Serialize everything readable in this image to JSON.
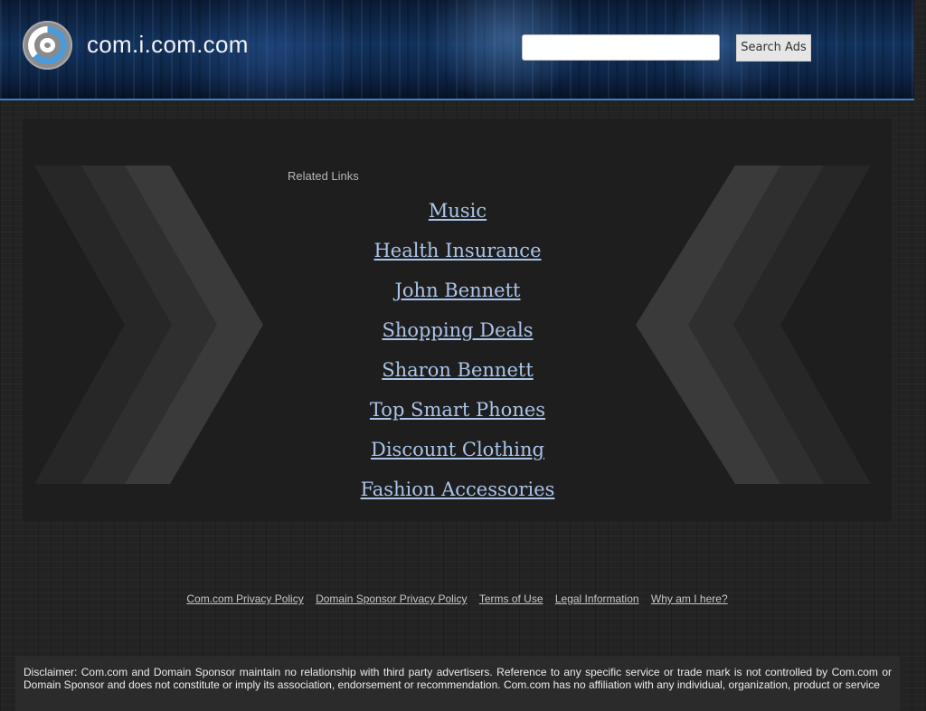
{
  "header": {
    "site_title": "com.i.com.com",
    "logo_icon": "com-logo-icon",
    "search": {
      "placeholder": "",
      "value": "",
      "button_label": "Search Ads"
    }
  },
  "main": {
    "related_label": "Related Links",
    "links": [
      {
        "label": "Music"
      },
      {
        "label": "Health Insurance"
      },
      {
        "label": "John Bennett"
      },
      {
        "label": "Shopping Deals"
      },
      {
        "label": "Sharon Bennett"
      },
      {
        "label": "Top Smart Phones"
      },
      {
        "label": "Discount Clothing"
      },
      {
        "label": "Fashion Accessories"
      }
    ]
  },
  "footer": {
    "links": [
      {
        "label": "Com.com Privacy Policy"
      },
      {
        "label": "Domain Sponsor Privacy Policy"
      },
      {
        "label": "Terms of Use"
      },
      {
        "label": "Legal Information"
      },
      {
        "label": "Why am I here?"
      }
    ],
    "disclaimer": "Disclaimer: Com.com and Domain Sponsor maintain no relationship with third party advertisers. Reference to any specific service or trade mark is not controlled by Com.com or Domain Sponsor and does not constitute or imply its association, endorsement or recommendation. Com.com has no affiliation with any individual, organization, product or service"
  },
  "colors": {
    "link": "#aac4e8",
    "header_accent": "#3b82c8",
    "background": "#232323"
  }
}
